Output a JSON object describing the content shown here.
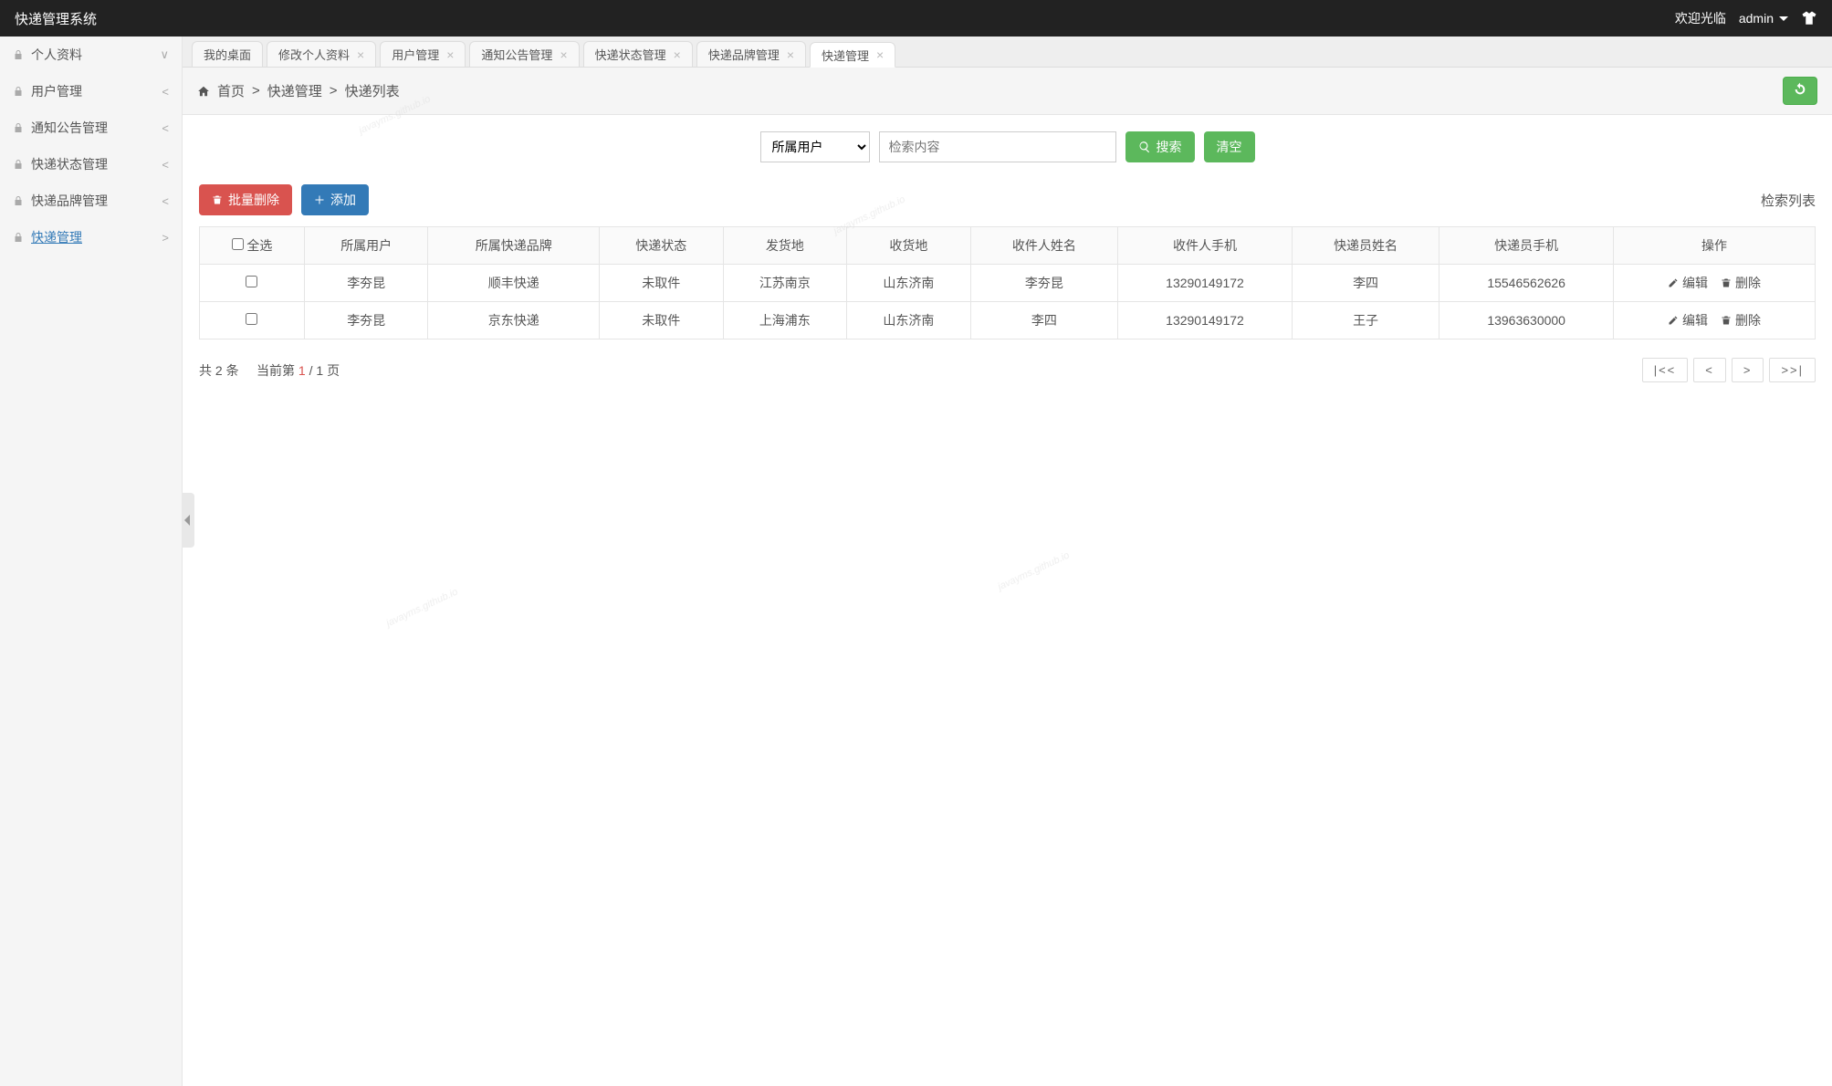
{
  "header": {
    "title": "快递管理系统",
    "welcome": "欢迎光临",
    "user": "admin"
  },
  "sidebar": {
    "items": [
      {
        "label": "个人资料",
        "arrow": "∨",
        "active": false
      },
      {
        "label": "用户管理",
        "arrow": "<",
        "active": false
      },
      {
        "label": "通知公告管理",
        "arrow": "<",
        "active": false
      },
      {
        "label": "快递状态管理",
        "arrow": "<",
        "active": false
      },
      {
        "label": "快递品牌管理",
        "arrow": "<",
        "active": false
      },
      {
        "label": "快递管理",
        "arrow": ">",
        "active": true
      }
    ]
  },
  "tabs": {
    "items": [
      {
        "label": "我的桌面",
        "close": false,
        "active": false
      },
      {
        "label": "修改个人资料",
        "close": true,
        "active": false
      },
      {
        "label": "用户管理",
        "close": true,
        "active": false
      },
      {
        "label": "通知公告管理",
        "close": true,
        "active": false
      },
      {
        "label": "快递状态管理",
        "close": true,
        "active": false
      },
      {
        "label": "快递品牌管理",
        "close": true,
        "active": false
      },
      {
        "label": "快递管理",
        "close": true,
        "active": true
      }
    ]
  },
  "breadcrumb": {
    "home": "首页",
    "sep": ">",
    "p1": "快递管理",
    "p2": "快递列表"
  },
  "search": {
    "select_label": "所属用户",
    "placeholder": "检索内容",
    "search_btn": "搜索",
    "clear_btn": "清空"
  },
  "toolbar": {
    "delete_btn": "批量删除",
    "add_btn": "添加",
    "list_title": "检索列表"
  },
  "table": {
    "check_all": "全选",
    "headers": [
      "所属用户",
      "所属快递品牌",
      "快递状态",
      "发货地",
      "收货地",
      "收件人姓名",
      "收件人手机",
      "快递员姓名",
      "快递员手机",
      "操作"
    ],
    "rows": [
      {
        "user": "李夯昆",
        "brand": "顺丰快递",
        "status": "未取件",
        "from": "江苏南京",
        "to": "山东济南",
        "rname": "李夯昆",
        "rphone": "13290149172",
        "cname": "李四",
        "cphone": "15546562626"
      },
      {
        "user": "李夯昆",
        "brand": "京东快递",
        "status": "未取件",
        "from": "上海浦东",
        "to": "山东济南",
        "rname": "李四",
        "rphone": "13290149172",
        "cname": "王子",
        "cphone": "13963630000"
      }
    ],
    "edit": "编辑",
    "del": "删除"
  },
  "pager": {
    "total_prefix": "共 ",
    "total": "2",
    "total_suffix": " 条",
    "cur_prefix": "当前第 ",
    "cur": "1",
    "sep": " / ",
    "pages": "1",
    "pages_suffix": " 页",
    "first": "|<<",
    "prev": "<",
    "next": ">",
    "last": ">>|"
  },
  "watermark": "javayms.github.io"
}
